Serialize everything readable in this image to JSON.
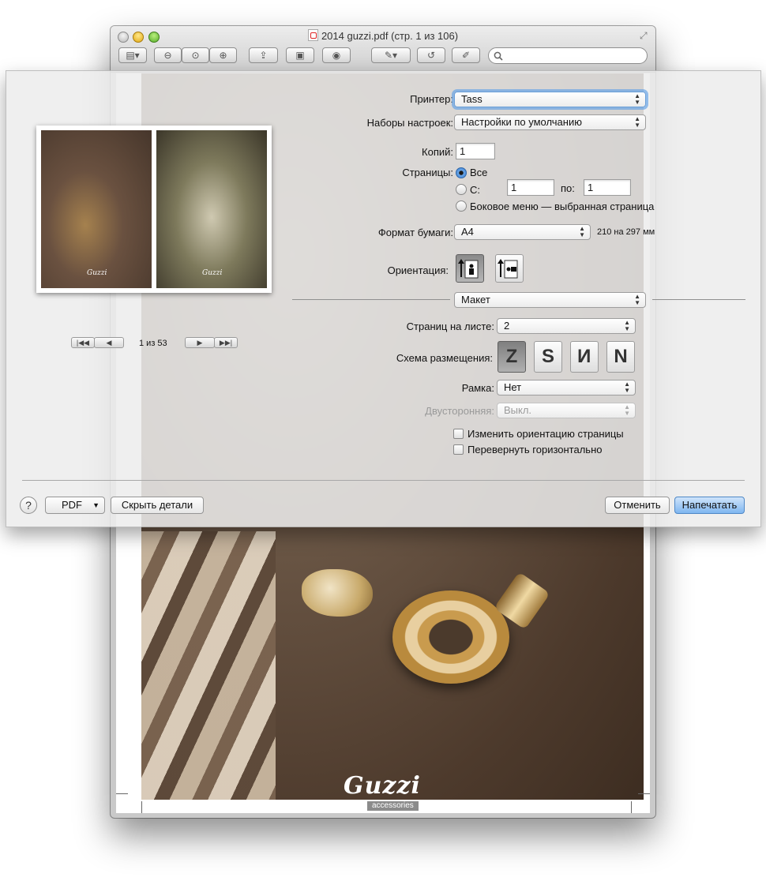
{
  "window": {
    "title": "2014 guzzi.pdf (стр. 1 из 106)",
    "search_placeholder": "",
    "logo_text": "Guzzi",
    "logo_sub": "accessories"
  },
  "dialog": {
    "printer_label": "Принтер:",
    "printer_value": "Tass",
    "presets_label": "Наборы настроек:",
    "presets_value": "Настройки по умолчанию",
    "copies_label": "Копий:",
    "copies_value": "1",
    "pages_label": "Страницы:",
    "pages_all": "Все",
    "pages_from": "С:",
    "pages_from_value": "1",
    "pages_to": "по:",
    "pages_to_value": "1",
    "pages_selection": "Боковое меню — выбранная страница",
    "paper_label": "Формат бумаги:",
    "paper_value": "A4",
    "paper_size": "210 на 297 мм",
    "orientation_label": "Ориентация:",
    "section_value": "Макет",
    "pages_per_sheet_label": "Страниц на листе:",
    "pages_per_sheet_value": "2",
    "layout_direction_label": "Схема размещения:",
    "border_label": "Рамка:",
    "border_value": "Нет",
    "two_sided_label": "Двусторонняя:",
    "two_sided_value": "Выкл.",
    "reverse_orientation": "Изменить ориентацию страницы",
    "flip_horizontal": "Перевернуть горизонтально",
    "preview_page": "1 из 53",
    "thumb_logo": "Guzzi",
    "help": "?",
    "pdf_button": "PDF",
    "hide_details": "Скрыть детали",
    "cancel": "Отменить",
    "print": "Напечатать"
  }
}
